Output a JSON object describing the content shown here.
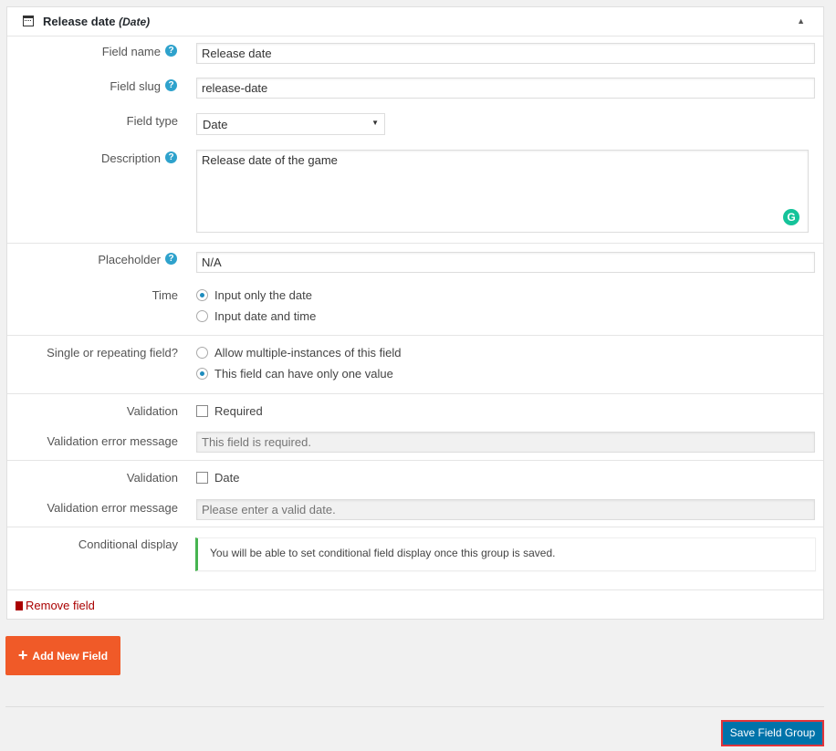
{
  "header": {
    "title": "Release date",
    "type": "(Date)",
    "icon": "calendar-icon"
  },
  "fields": {
    "field_name": {
      "label": "Field name",
      "value": "Release date"
    },
    "field_slug": {
      "label": "Field slug",
      "value": "release-date"
    },
    "field_type": {
      "label": "Field type",
      "value": "Date"
    },
    "description": {
      "label": "Description",
      "value": "Release date of the game"
    },
    "placeholder": {
      "label": "Placeholder",
      "value": "N/A"
    },
    "time": {
      "label": "Time",
      "options": [
        "Input only the date",
        "Input date and time"
      ],
      "selected": 0
    },
    "repeating": {
      "label": "Single or repeating field?",
      "options": [
        "Allow multiple-instances of this field",
        "This field can have only one value"
      ],
      "selected": 1
    },
    "validation1": {
      "label": "Validation",
      "checkbox": "Required",
      "checked": false,
      "error_label": "Validation error message",
      "error_placeholder": "This field is required."
    },
    "validation2": {
      "label": "Validation",
      "checkbox": "Date",
      "checked": false,
      "error_label": "Validation error message",
      "error_placeholder": "Please enter a valid date."
    },
    "conditional": {
      "label": "Conditional display",
      "notice": "You will be able to set conditional field display once this group is saved."
    }
  },
  "remove_label": "Remove field",
  "add_label": "Add New Field",
  "save_label": "Save Field Group",
  "colors": {
    "add": "#f05a28",
    "save": "#0073aa",
    "save_outline": "#e3343a",
    "notice": "#46b450",
    "help": "#2ea2cc"
  }
}
